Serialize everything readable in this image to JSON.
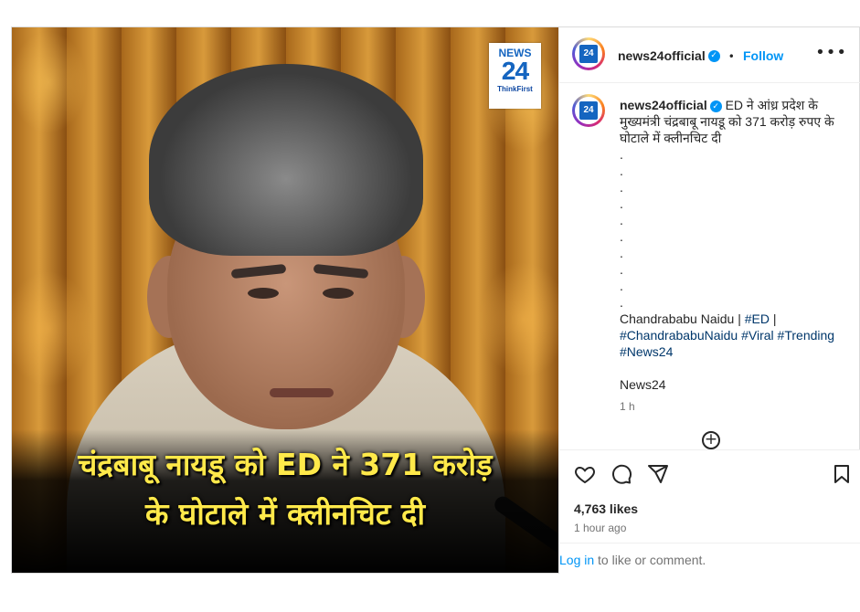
{
  "post": {
    "image": {
      "logo_top": "NEWS",
      "logo_number": "24",
      "logo_tagline": "ThinkFirst",
      "headline_line1": "चंद्रबाबू नायडू को ED ने 371 करोड़",
      "headline_line2": "के घोटाले में क्लीनचिट दी"
    },
    "header": {
      "username": "news24official",
      "separator": "•",
      "follow_label": "Follow",
      "more_label": "•••"
    },
    "caption": {
      "username": "news24official",
      "text": "ED ने आंध्र प्रदेश के मुख्यमंत्री चंद्रबाबू नायडू को 371 करोड़ रुपए के घोटाले में क्लीनचिट दी",
      "dots": [
        ".",
        ".",
        ".",
        ".",
        ".",
        ".",
        ".",
        ".",
        ".",
        "."
      ],
      "tags_line": {
        "plain1": "Chandrababu Naidu | ",
        "tag_ed": "#ED",
        "plain2": " | ",
        "tag_name": "#ChandrababuNaidu",
        "tag_viral": "#Viral",
        "tag_trending": "#Trending",
        "tag_news24": "#News24"
      },
      "signature": "News24",
      "time": "1 h"
    },
    "stats": {
      "likes": "4,763 likes",
      "posted": "1 hour ago"
    },
    "login": {
      "link": "Log in",
      "rest": " to like or comment."
    },
    "colors": {
      "accent_blue": "#0095f6",
      "hashtag": "#00376b",
      "headline_yellow": "#ffe94a"
    }
  }
}
